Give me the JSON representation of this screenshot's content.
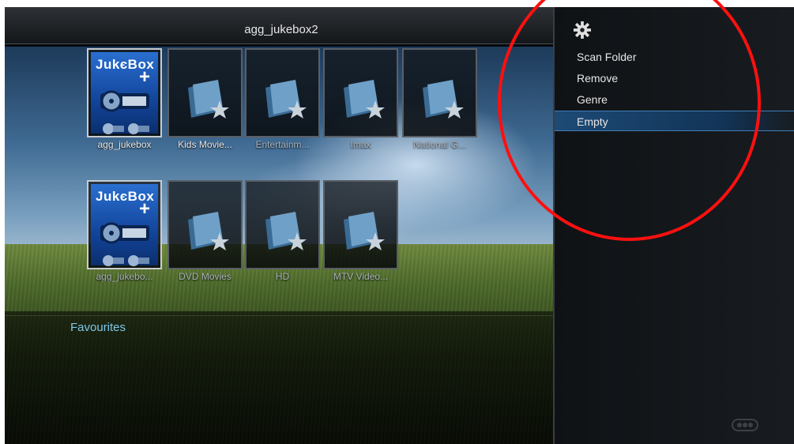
{
  "header": {
    "title": "agg_jukebox2"
  },
  "grid": {
    "row1": [
      {
        "label": "agg_jukebox",
        "type": "jukebox"
      },
      {
        "label": "Kids Movie...",
        "type": "folder"
      },
      {
        "label": "Entertainm...",
        "type": "folder"
      },
      {
        "label": "Imax",
        "type": "folder"
      },
      {
        "label": "National G...",
        "type": "folder"
      }
    ],
    "row2": [
      {
        "label": "agg_jukebo...",
        "type": "jukebox"
      },
      {
        "label": "DVD Movies",
        "type": "folder"
      },
      {
        "label": "HD",
        "type": "folder"
      },
      {
        "label": "MTV Video...",
        "type": "folder"
      }
    ],
    "jukebox_text": "JukєBox",
    "jukebox_plus": "+"
  },
  "section": {
    "favourites_label": "Favourites"
  },
  "menu": {
    "icon": "gear-icon",
    "items": [
      {
        "label": "Scan Folder"
      },
      {
        "label": "Remove"
      },
      {
        "label": "Genre"
      },
      {
        "label": "Empty",
        "selected": true
      }
    ]
  },
  "footer": {
    "icon": "remote-icon"
  },
  "colors": {
    "accent": "#7ec6e8",
    "selection": "#1d4a76",
    "annotation": "#ff1010"
  }
}
